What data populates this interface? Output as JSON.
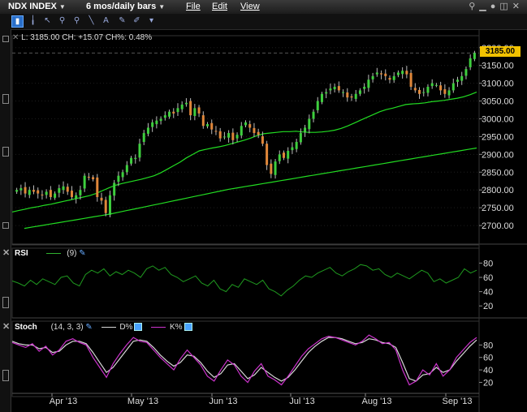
{
  "menubar": {
    "symbol": "NDX INDEX",
    "period": "6 mos/daily bars",
    "file": "File",
    "edit": "Edit",
    "view": "View"
  },
  "price_panel": {
    "info": "L: 3185.00 CH: +15.07 CH%: 0.48%",
    "last_tag": "3185.00",
    "yticks": [
      "3200.00",
      "3150.00",
      "3100.00",
      "3050.00",
      "3000.00",
      "2950.00",
      "2900.00",
      "2850.00",
      "2800.00",
      "2750.00",
      "2700.00"
    ]
  },
  "rsi_panel": {
    "label": "RSI",
    "param": "(9)",
    "yticks": [
      "80",
      "60",
      "40",
      "20"
    ]
  },
  "stoch_panel": {
    "label": "Stoch",
    "param": "(14, 3, 3)",
    "d_label": "D%",
    "k_label": "K%",
    "yticks": [
      "80",
      "60",
      "40",
      "20"
    ]
  },
  "xaxis": {
    "ticks": [
      "Apr '13",
      "May '13",
      "Jun '13",
      "Jul '13",
      "Aug '13",
      "Sep '13"
    ]
  },
  "colors": {
    "up": "#3ecf3e",
    "down": "#e0873a",
    "ma": "#22dd22",
    "rsi": "#1f9a1f",
    "stoch_d": "#d8d8d8",
    "stoch_k": "#cc33cc",
    "last_tag": "#f2c200"
  },
  "chart_data": {
    "type": "candlestick",
    "title": "",
    "price_series_closes": [
      2800,
      2805,
      2790,
      2800,
      2795,
      2790,
      2785,
      2795,
      2780,
      2790,
      2805,
      2810,
      2795,
      2780,
      2785,
      2800,
      2840,
      2835,
      2830,
      2780,
      2770,
      2735,
      2785,
      2820,
      2840,
      2850,
      2870,
      2890,
      2890,
      2930,
      2960,
      2975,
      2990,
      2995,
      3000,
      3010,
      3020,
      3015,
      3030,
      3040,
      3045,
      3010,
      3030,
      3015,
      2980,
      2985,
      2970,
      2965,
      2945,
      2950,
      2960,
      2940,
      2955,
      2980,
      2990,
      2975,
      2960,
      2955,
      2930,
      2870,
      2845,
      2880,
      2900,
      2890,
      2910,
      2920,
      2935,
      2960,
      2975,
      3000,
      3020,
      3050,
      3070,
      3075,
      3085,
      3090,
      3080,
      3075,
      3060,
      3060,
      3070,
      3080,
      3090,
      3110,
      3120,
      3130,
      3125,
      3120,
      3110,
      3120,
      3130,
      3135,
      3125,
      3090,
      3080,
      3070,
      3075,
      3090,
      3100,
      3095,
      3080,
      3070,
      3080,
      3100,
      3110,
      3120,
      3140,
      3170,
      3185
    ],
    "ma_fast": [
      2738,
      2742,
      2746,
      2750,
      2753,
      2757,
      2760,
      2764,
      2768,
      2772,
      2776,
      2780,
      2784,
      2790,
      2798,
      2806,
      2813,
      2818,
      2822,
      2826,
      2830,
      2835,
      2840,
      2848,
      2858,
      2868,
      2878,
      2890,
      2900,
      2910,
      2914,
      2918,
      2921,
      2925,
      2930,
      2935,
      2940,
      2946,
      2953,
      2958,
      2960,
      2962,
      2964,
      2964,
      2965,
      2963,
      2962,
      2962,
      2963,
      2965,
      2968,
      2973,
      2980,
      2988,
      2996,
      3004,
      3012,
      3020,
      3026,
      3030,
      3035,
      3040,
      3042,
      3043,
      3045,
      3048,
      3050,
      3052,
      3055,
      3058,
      3062,
      3068,
      3075
    ],
    "ma_slow": [
      2692,
      2696,
      2700,
      2704,
      2708,
      2712,
      2716,
      2720,
      2724,
      2728,
      2732,
      2737,
      2742,
      2747,
      2752,
      2757,
      2762,
      2767,
      2772,
      2777,
      2782,
      2787,
      2792,
      2797,
      2802,
      2806,
      2810,
      2814,
      2818,
      2822,
      2826,
      2830,
      2834,
      2838,
      2842,
      2846,
      2850,
      2854,
      2858,
      2862,
      2866,
      2870,
      2874,
      2878,
      2882,
      2886,
      2890,
      2894,
      2898,
      2902,
      2906,
      2910,
      2914,
      2918
    ],
    "rsi": [
      55,
      52,
      48,
      56,
      50,
      58,
      54,
      50,
      60,
      62,
      52,
      48,
      64,
      70,
      66,
      72,
      62,
      68,
      64,
      70,
      66,
      60,
      72,
      76,
      70,
      74,
      64,
      60,
      54,
      58,
      62,
      52,
      48,
      56,
      44,
      40,
      50,
      46,
      58,
      54,
      50,
      56,
      44,
      40,
      34,
      42,
      48,
      56,
      62,
      60,
      66,
      70,
      74,
      66,
      62,
      68,
      72,
      78,
      76,
      70,
      72,
      64,
      60,
      66,
      62,
      58,
      64,
      70,
      66,
      54,
      58,
      52,
      56,
      60,
      72,
      66,
      70
    ],
    "stoch_k": [
      84,
      80,
      76,
      82,
      70,
      78,
      64,
      72,
      86,
      90,
      84,
      80,
      60,
      44,
      28,
      50,
      66,
      80,
      92,
      86,
      84,
      72,
      60,
      50,
      40,
      58,
      72,
      60,
      48,
      30,
      22,
      40,
      56,
      48,
      30,
      20,
      38,
      50,
      30,
      24,
      16,
      30,
      46,
      62,
      74,
      82,
      90,
      94,
      92,
      88,
      84,
      80,
      86,
      96,
      90,
      82,
      84,
      72,
      40,
      16,
      22,
      40,
      32,
      50,
      30,
      40,
      60,
      72,
      84,
      92
    ],
    "stoch_d": [
      86,
      82,
      80,
      80,
      74,
      76,
      68,
      70,
      80,
      86,
      86,
      82,
      68,
      52,
      36,
      44,
      58,
      72,
      86,
      88,
      86,
      76,
      64,
      54,
      46,
      52,
      64,
      62,
      52,
      38,
      28,
      34,
      48,
      50,
      38,
      26,
      32,
      44,
      36,
      28,
      22,
      28,
      40,
      54,
      68,
      78,
      86,
      92,
      92,
      90,
      86,
      82,
      84,
      90,
      88,
      84,
      82,
      76,
      52,
      26,
      22,
      32,
      34,
      44,
      36,
      40,
      54,
      66,
      78,
      88
    ],
    "xlabel": "",
    "ylabel": "",
    "ylim": [
      2650,
      3220
    ]
  }
}
